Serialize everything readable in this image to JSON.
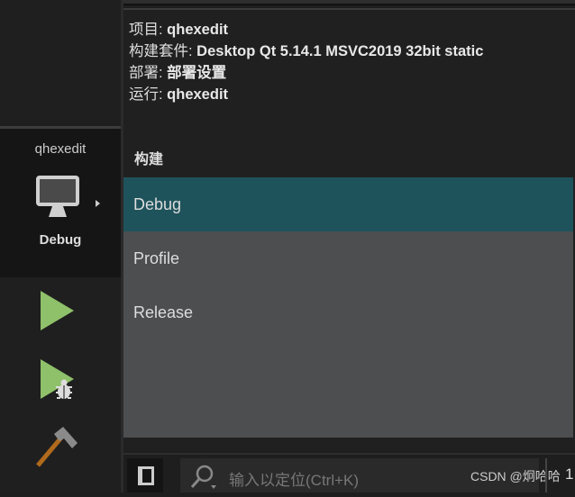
{
  "sidebar": {
    "kit": {
      "project": "qhexedit",
      "config": "Debug",
      "icon": "monitor-icon"
    },
    "run_icon": "play-icon",
    "debug_icon": "play-bug-icon",
    "build_icon": "hammer-icon"
  },
  "panel": {
    "info": [
      {
        "label": "项目: ",
        "value": "qhexedit"
      },
      {
        "label": "构建套件: ",
        "value": "Desktop Qt 5.14.1 MSVC2019 32bit static"
      },
      {
        "label": "部署: ",
        "value": "部署设置"
      },
      {
        "label": "运行: ",
        "value": "qhexedit"
      }
    ],
    "build_heading": "构建",
    "build_configs": [
      {
        "label": "Debug",
        "selected": true
      },
      {
        "label": "Profile"
      },
      {
        "label": "Release"
      }
    ]
  },
  "bottom": {
    "search_placeholder": "输入以定位(Ctrl+K)",
    "watermark": "CSDN @炯哈哈",
    "trailing": "1"
  },
  "colors": {
    "selected": "#1e535b",
    "list_bg": "#4d4e50",
    "run_green": "#8fc06a"
  }
}
